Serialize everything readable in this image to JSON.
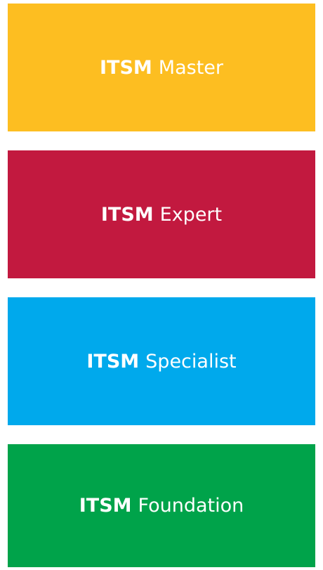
{
  "levels": [
    {
      "prefix": "ITSM",
      "name": "Master",
      "color": "#FDBE21"
    },
    {
      "prefix": "ITSM",
      "name": "Expert",
      "color": "#C2193F"
    },
    {
      "prefix": "ITSM",
      "name": "Specialist",
      "color": "#00A9EC"
    },
    {
      "prefix": "ITSM",
      "name": "Foundation",
      "color": "#00A34A"
    }
  ]
}
